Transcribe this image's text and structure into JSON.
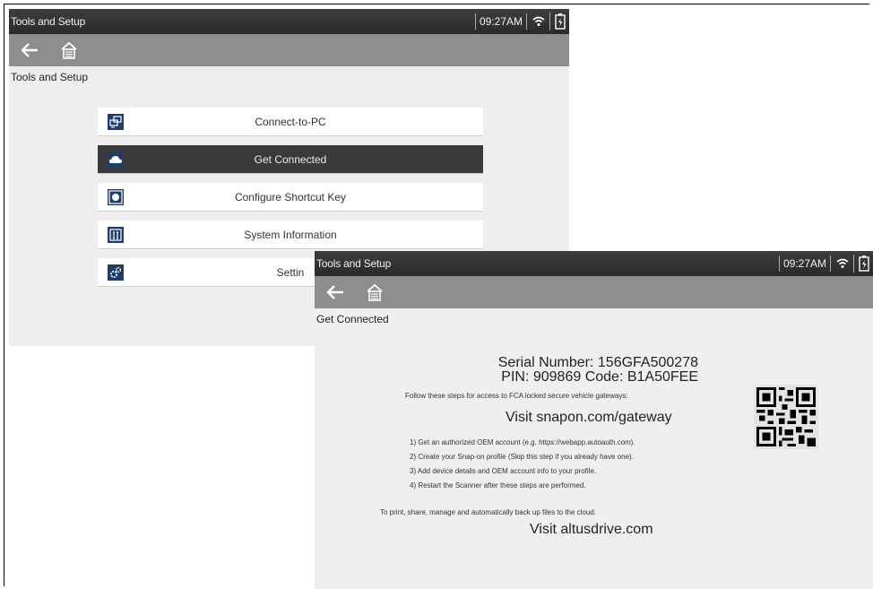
{
  "back_screen": {
    "status": {
      "title": "Tools and Setup",
      "time": "09:27AM"
    },
    "breadcrumb": "Tools and Setup",
    "menu": [
      {
        "label": "Connect-to-PC",
        "icon": "pc-connect-icon",
        "active": false
      },
      {
        "label": "Get Connected",
        "icon": "cloud-icon",
        "active": true
      },
      {
        "label": "Configure Shortcut Key",
        "icon": "shortcut-key-icon",
        "active": false
      },
      {
        "label": "System Information",
        "icon": "info-icon",
        "active": false
      },
      {
        "label": "Settin",
        "icon": "settings-gear-icon",
        "active": false
      }
    ]
  },
  "front_screen": {
    "status": {
      "title": "Tools and Setup",
      "time": "09:27AM"
    },
    "breadcrumb": "Get Connected",
    "serial_line": "Serial Number: 156GFA500278",
    "pin_line": "PIN: 909869  Code: B1A50FEE",
    "follow_text": "Follow these steps for access to FCA locked secure vehicle gateways:",
    "visit_gateway": "Visit snapon.com/gateway",
    "steps": [
      "1)  Get an authorized OEM account (e.g. https://webapp.autoauth.com).",
      "2)  Create your Snap-on profile (Skip this step if you already have one).",
      "3)  Add device details and OEM account info to your profile.",
      "4)  Restart the Scanner after these steps are performed."
    ],
    "cloud_text": "To print, share, manage and automatically back up files to the cloud.",
    "visit_altus": "Visit altusdrive.com",
    "qr_icon": "qr-code-icon"
  },
  "colors": {
    "statusbar": "#333333",
    "navbar": "#8e8e8e",
    "active_item": "#3a3a3a",
    "icon_blue": "#1f3d66"
  }
}
